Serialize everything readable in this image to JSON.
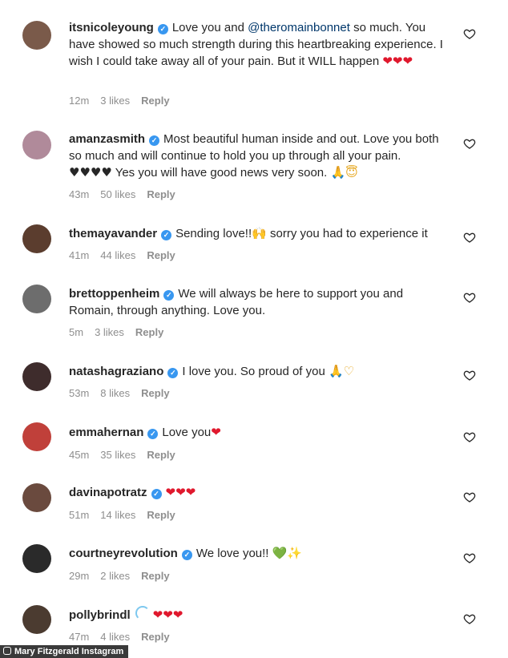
{
  "comments": [
    {
      "username": "itsnicoleyoung",
      "text_a": "Love you and ",
      "mention": "@theromainbonnet",
      "text_b": " so much. You have showed so much strength during this heartbreaking experience. I wish I could take away all of your pain. But it WILL happen ",
      "emoji": "❤❤❤",
      "time": "12m",
      "likes": "3 likes",
      "reply": "Reply",
      "avatar_color": "#7a5a4a"
    },
    {
      "username": "amanzasmith",
      "text": "Most beautiful human inside and out. Love you both so much and will continue to hold you up through all your pain. ",
      "emoji_hearts": "♥♥♥♥",
      "text_b": " Yes you will have good news very soon. ",
      "emoji_end": "🙏😇",
      "time": "43m",
      "likes": "50 likes",
      "reply": "Reply",
      "avatar_color": "#b08a9a"
    },
    {
      "username": "themayavander",
      "text": "Sending love!!",
      "emoji": "🙌",
      "text_b": " sorry you had to experience it",
      "time": "41m",
      "likes": "44 likes",
      "reply": "Reply",
      "avatar_color": "#5b3d2e"
    },
    {
      "username": "brettoppenheim",
      "text": "We will always be here to support you and Romain, through anything. Love you.",
      "time": "5m",
      "likes": "3 likes",
      "reply": "Reply",
      "avatar_color": "#6d6d6d"
    },
    {
      "username": "natashagraziano",
      "text": "I love you. So proud of you ",
      "emoji": "🙏♡",
      "time": "53m",
      "likes": "8 likes",
      "reply": "Reply",
      "avatar_color": "#3e2c2c"
    },
    {
      "username": "emmahernan",
      "text": "Love you",
      "emoji": "❤",
      "time": "45m",
      "likes": "35 likes",
      "reply": "Reply",
      "avatar_color": "#c0403a"
    },
    {
      "username": "davinapotratz",
      "text": "",
      "emoji": "❤❤❤",
      "time": "51m",
      "likes": "14 likes",
      "reply": "Reply",
      "avatar_color": "#6a4a3e"
    },
    {
      "username": "courtneyrevolution",
      "text": "We love you!! ",
      "emoji_green": "💚",
      "emoji_spark": "✨",
      "time": "29m",
      "likes": "2 likes",
      "reply": "Reply",
      "avatar_color": "#2a2a2a"
    },
    {
      "username": "pollybrindl",
      "emoji": "❤❤❤",
      "time": "47m",
      "likes": "4 likes",
      "reply": "Reply",
      "avatar_color": "#4b3b30"
    }
  ],
  "credit": "Mary Fitzgerald Instagram"
}
